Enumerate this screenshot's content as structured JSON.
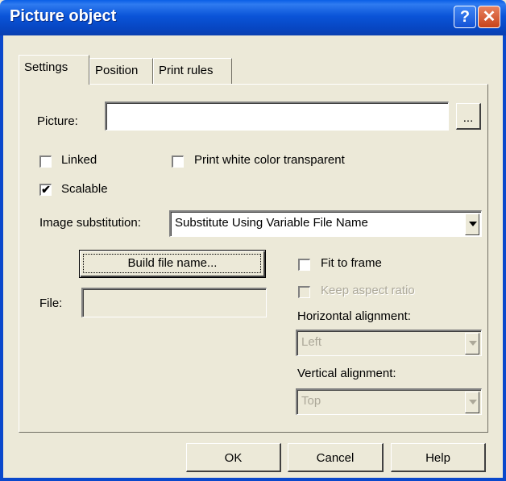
{
  "window": {
    "title": "Picture object",
    "help_glyph": "?",
    "close_glyph": "✕"
  },
  "tabs": [
    {
      "label": "Settings",
      "active": true
    },
    {
      "label": "Position",
      "active": false
    },
    {
      "label": "Print rules",
      "active": false
    }
  ],
  "settings": {
    "picture_label": "Picture:",
    "picture_value": "",
    "browse_label": "...",
    "linked": {
      "label": "Linked",
      "checked": false
    },
    "print_white_transparent": {
      "label": "Print white color transparent",
      "checked": false
    },
    "scalable": {
      "label": "Scalable",
      "checked": true,
      "mark": "✔"
    },
    "image_substitution_label": "Image substitution:",
    "image_substitution_value": "Substitute Using Variable File Name",
    "build_file_name_label": "Build file name...",
    "file_label": "File:",
    "file_value": "",
    "fit_to_frame": {
      "label": "Fit to frame",
      "checked": false
    },
    "keep_aspect_ratio": {
      "label": "Keep aspect ratio",
      "checked": false,
      "enabled": false
    },
    "horizontal_alignment_label": "Horizontal alignment:",
    "horizontal_alignment_value": "Left",
    "vertical_alignment_label": "Vertical alignment:",
    "vertical_alignment_value": "Top"
  },
  "footer": {
    "ok_label": "OK",
    "cancel_label": "Cancel",
    "help_label": "Help"
  }
}
